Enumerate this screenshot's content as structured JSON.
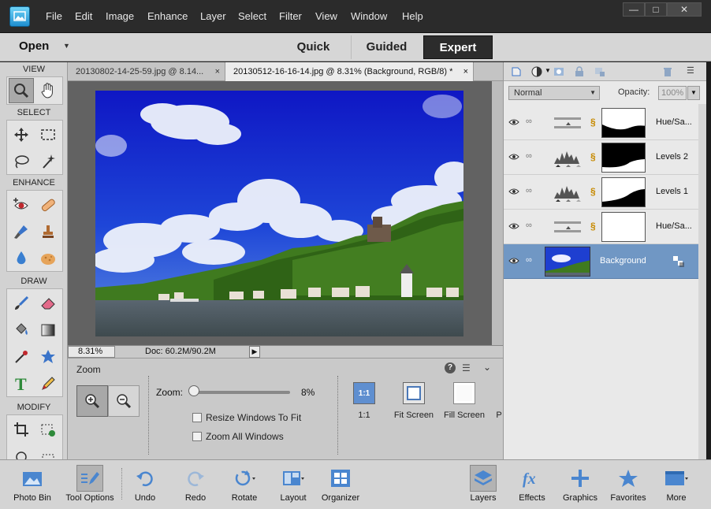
{
  "menubar": {
    "items": [
      "File",
      "Edit",
      "Image",
      "Enhance",
      "Layer",
      "Select",
      "Filter",
      "View",
      "Window",
      "Help"
    ]
  },
  "modebar": {
    "open_label": "Open",
    "tabs": [
      "Quick",
      "Guided",
      "Expert"
    ],
    "active_tab": "Expert"
  },
  "toolbox": {
    "sections": [
      "VIEW",
      "SELECT",
      "ENHANCE",
      "DRAW",
      "MODIFY"
    ]
  },
  "document_tabs": [
    {
      "title": "20130802-14-25-59.jpg @ 8.14...",
      "close": "×"
    },
    {
      "title": "20130512-16-16-14.jpg @ 8.31% (Background, RGB/8) *",
      "close": "×"
    }
  ],
  "status": {
    "zoom": "8.31%",
    "doc_size": "Doc: 60.2M/90.2M"
  },
  "tool_options": {
    "title": "Zoom",
    "zoom_label": "Zoom:",
    "zoom_value": "8%",
    "zoom_fraction": 0.08,
    "resize_windows_label": "Resize Windows To Fit",
    "zoom_all_label": "Zoom All Windows",
    "presets": [
      "1:1",
      "Fit Screen",
      "Fill Screen",
      "P"
    ],
    "preset_icon_label": "1:1",
    "help": "?"
  },
  "layers": {
    "blend_mode": "Normal",
    "opacity_label": "Opacity:",
    "opacity_value": "100%",
    "items": [
      {
        "name": "Hue/Sa...",
        "type": "hue"
      },
      {
        "name": "Levels 2",
        "type": "levels"
      },
      {
        "name": "Levels 1",
        "type": "levels"
      },
      {
        "name": "Hue/Sa...",
        "type": "hue"
      },
      {
        "name": "Background",
        "type": "background",
        "selected": true
      }
    ]
  },
  "taskbar": {
    "left": [
      "Photo Bin",
      "Tool Options",
      "Undo",
      "Redo",
      "Rotate",
      "Layout",
      "Organizer"
    ],
    "right": [
      "Layers",
      "Effects",
      "Graphics",
      "Favorites",
      "More"
    ]
  },
  "colors": {
    "accent_selected": "#7097c4",
    "chrome_dark": "#2b2b2b",
    "panel_bg": "#d2d2d2"
  }
}
